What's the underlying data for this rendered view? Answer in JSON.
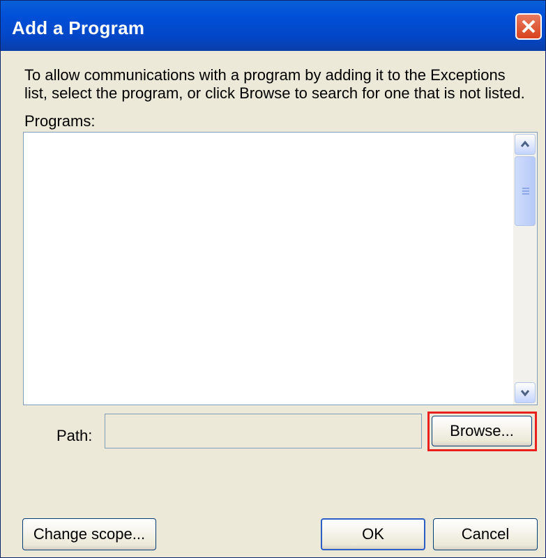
{
  "window": {
    "title": "Add a Program"
  },
  "dialog": {
    "description": "To allow communications with a program by adding it to the Exceptions list, select the program, or click Browse to search for one that is not listed.",
    "programs_label": "Programs:",
    "path_label": "Path:",
    "path_value": ""
  },
  "buttons": {
    "browse": "Browse...",
    "change_scope": "Change scope...",
    "ok": "OK",
    "cancel": "Cancel"
  },
  "icons": {
    "close": "close-icon",
    "scroll_up": "chevron-up-icon",
    "scroll_down": "chevron-down-icon"
  },
  "colors": {
    "titlebar": "#0150d8",
    "dialog_background": "#ece9d8",
    "highlight": "#e8201e",
    "close_button": "#d8421c"
  }
}
